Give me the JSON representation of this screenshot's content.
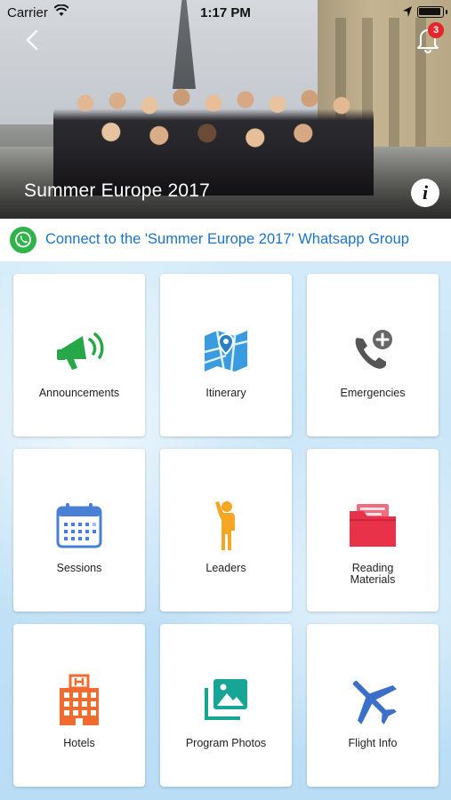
{
  "status_bar": {
    "carrier": "Carrier",
    "time": "1:17 PM"
  },
  "header": {
    "title": "Summer Europe 2017",
    "notification_count": "3",
    "info_glyph": "i"
  },
  "whatsapp": {
    "text": "Connect to the 'Summer Europe 2017' Whatsapp Group",
    "color": "#1a73c9",
    "icon_color": "#2fb34a"
  },
  "tiles": [
    {
      "label": "Announcements",
      "icon": "megaphone-icon",
      "color": "#27a74a"
    },
    {
      "label": "Itinerary",
      "icon": "map-icon",
      "color": "#3a9be0"
    },
    {
      "label": "Emergencies",
      "icon": "phone-plus-icon",
      "color": "#555555"
    },
    {
      "label": "Sessions",
      "icon": "calendar-icon",
      "color": "#4a7fd6"
    },
    {
      "label": "Leaders",
      "icon": "person-icon",
      "color": "#f5a623"
    },
    {
      "label": "Reading Materials",
      "icon": "folder-icon",
      "color": "#e8324a"
    },
    {
      "label": "Hotels",
      "icon": "hotel-icon",
      "color": "#f26a2e"
    },
    {
      "label": "Program Photos",
      "icon": "photos-icon",
      "color": "#17a596"
    },
    {
      "label": "Flight Info",
      "icon": "airplane-icon",
      "color": "#3b6fc9"
    }
  ]
}
